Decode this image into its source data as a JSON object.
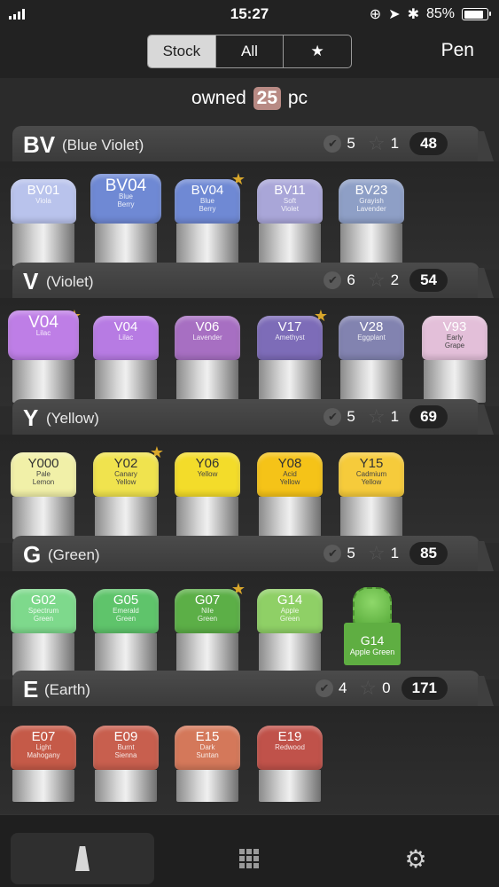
{
  "status": {
    "time": "15:27",
    "battery": "85%"
  },
  "nav": {
    "seg_stock": "Stock",
    "seg_all": "All",
    "seg_star": "★",
    "pen": "Pen"
  },
  "owned": {
    "prefix": "owned",
    "count": "25",
    "suffix": "pc"
  },
  "sections": [
    {
      "code": "BV",
      "name": "(Blue Violet)",
      "checked": "5",
      "starred": "1",
      "total": "48",
      "markers": [
        {
          "code": "BV01",
          "name": "Viola",
          "color": "#b9c3ec"
        },
        {
          "code": "BV04",
          "name": "Blue\nBerry",
          "color": "#6f89d4"
        },
        {
          "code": "BV04",
          "name": "Blue\nBerry",
          "color": "#6f89d4"
        },
        {
          "code": "BV11",
          "name": "Soft\nViolet",
          "color": "#a9a6d8"
        },
        {
          "code": "BV23",
          "name": "Grayish\nLavender",
          "color": "#8e9fc6"
        }
      ]
    },
    {
      "code": "V",
      "name": "(Violet)",
      "checked": "6",
      "starred": "2",
      "total": "54",
      "markers": [
        {
          "code": "V04",
          "name": "Lilac",
          "color": "#be7ee6"
        },
        {
          "code": "V04",
          "name": "Lilac",
          "color": "#b77be3"
        },
        {
          "code": "V06",
          "name": "Lavender",
          "color": "#a76fc2"
        },
        {
          "code": "V17",
          "name": "Amethyst",
          "color": "#7d6cb8"
        },
        {
          "code": "V28",
          "name": "Eggplant",
          "color": "#8283b0"
        },
        {
          "code": "V93",
          "name": "Early\nGrape",
          "color": "#e3bfd9"
        }
      ]
    },
    {
      "code": "Y",
      "name": "(Yellow)",
      "checked": "5",
      "starred": "1",
      "total": "69",
      "markers": [
        {
          "code": "Y000",
          "name": "Pale\nLemon",
          "color": "#f1f0a8"
        },
        {
          "code": "Y02",
          "name": "Canary\nYellow",
          "color": "#f0e34e"
        },
        {
          "code": "Y06",
          "name": "Yellow",
          "color": "#f3dc2a"
        },
        {
          "code": "Y08",
          "name": "Acid\nYellow",
          "color": "#f5c318"
        },
        {
          "code": "Y15",
          "name": "Cadmium\nYellow",
          "color": "#f6cb3b"
        }
      ]
    },
    {
      "code": "G",
      "name": "(Green)",
      "checked": "5",
      "starred": "1",
      "total": "85",
      "markers": [
        {
          "code": "G02",
          "name": "Spectrum\nGreen",
          "color": "#7ed98c"
        },
        {
          "code": "G05",
          "name": "Emerald\nGreen",
          "color": "#5fc46b"
        },
        {
          "code": "G07",
          "name": "Nile\nGreen",
          "color": "#5caf47"
        },
        {
          "code": "G14",
          "name": "Apple\nGreen",
          "color": "#8fd066"
        }
      ],
      "preview": {
        "code": "G14",
        "name": "Apple Green"
      }
    },
    {
      "code": "E",
      "name": "(Earth)",
      "checked": "4",
      "starred": "0",
      "total": "171",
      "markers": [
        {
          "code": "E07",
          "name": "Light\nMahogany",
          "color": "#c55a48"
        },
        {
          "code": "E09",
          "name": "Burnt\nSienna",
          "color": "#c85f4e"
        },
        {
          "code": "E15",
          "name": "Dark\nSuntan",
          "color": "#d4785a"
        },
        {
          "code": "E19",
          "name": "Redwood",
          "color": "#c0524a"
        }
      ]
    }
  ]
}
